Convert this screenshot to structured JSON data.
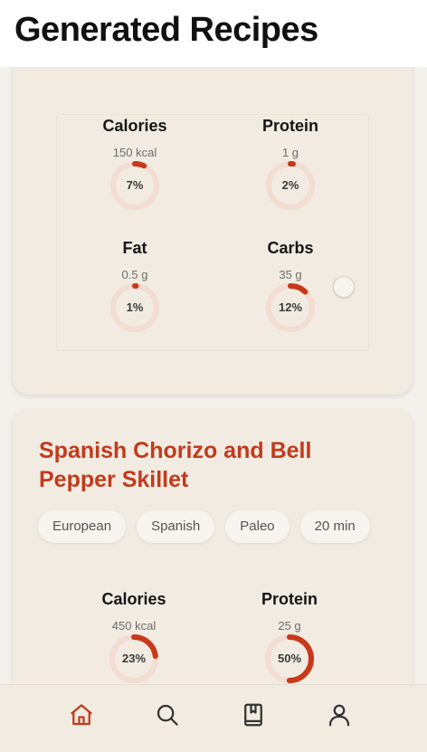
{
  "page": {
    "title": "Generated Recipes"
  },
  "recipes": [
    {
      "nutrition": [
        {
          "name": "Calories",
          "amount": "150 kcal",
          "percent_label": "7%",
          "percent": 7
        },
        {
          "name": "Protein",
          "amount": "1 g",
          "percent_label": "2%",
          "percent": 2
        },
        {
          "name": "Fat",
          "amount": "0.5 g",
          "percent_label": "1%",
          "percent": 1
        },
        {
          "name": "Carbs",
          "amount": "35 g",
          "percent_label": "12%",
          "percent": 12
        }
      ]
    },
    {
      "title": "Spanish Chorizo and Bell Pepper Skillet",
      "tags": [
        "European",
        "Spanish",
        "Paleo",
        "20 min"
      ],
      "nutrition": [
        {
          "name": "Calories",
          "amount": "450 kcal",
          "percent_label": "23%",
          "percent": 23
        },
        {
          "name": "Protein",
          "amount": "25 g",
          "percent_label": "50%",
          "percent": 50
        }
      ]
    }
  ],
  "nav": {
    "items": [
      {
        "icon": "home-icon",
        "active": true
      },
      {
        "icon": "search-icon",
        "active": false
      },
      {
        "icon": "bookmark-book-icon",
        "active": false
      },
      {
        "icon": "profile-icon",
        "active": false
      }
    ]
  },
  "colors": {
    "accent": "#c23a1c",
    "ring_track": "#f3dcd2",
    "ring_fill": "#c8381a"
  }
}
